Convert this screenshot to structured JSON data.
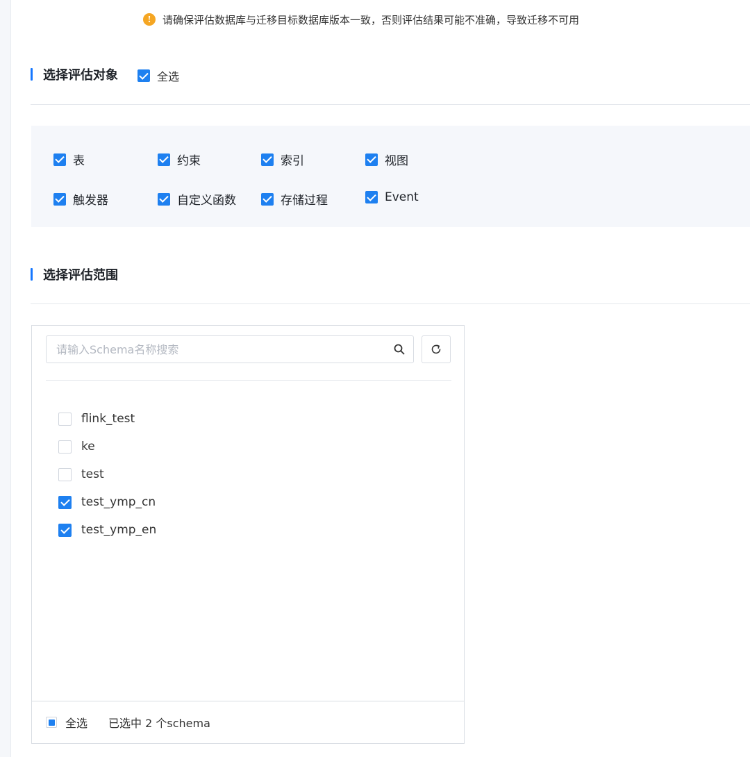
{
  "notice": {
    "icon": "info-icon",
    "text": "请确保评估数据库与迁移目标数据库版本一致，否则评估结果可能不准确，导致迁移不可用"
  },
  "objects_section": {
    "title": "选择评估对象",
    "select_all_label": "全选",
    "select_all_checked": true,
    "items": [
      {
        "label": "表",
        "checked": true
      },
      {
        "label": "约束",
        "checked": true
      },
      {
        "label": "索引",
        "checked": true
      },
      {
        "label": "视图",
        "checked": true
      },
      {
        "label": "触发器",
        "checked": true
      },
      {
        "label": "自定义函数",
        "checked": true
      },
      {
        "label": "存储过程",
        "checked": true
      },
      {
        "label": "Event",
        "checked": true
      }
    ]
  },
  "scope_section": {
    "title": "选择评估范围",
    "search_placeholder": "请输入Schema名称搜索",
    "schemas": [
      {
        "name": "flink_test",
        "checked": false
      },
      {
        "name": "ke",
        "checked": false
      },
      {
        "name": "test",
        "checked": false
      },
      {
        "name": "test_ymp_cn",
        "checked": true
      },
      {
        "name": "test_ymp_en",
        "checked": true
      }
    ],
    "footer": {
      "select_all_label": "全选",
      "selected_count_text": "已选中 2 个schema"
    }
  },
  "colors": {
    "accent": "#1e80f0",
    "warning": "#f5a623",
    "panel_bg": "#f5f7fb"
  }
}
